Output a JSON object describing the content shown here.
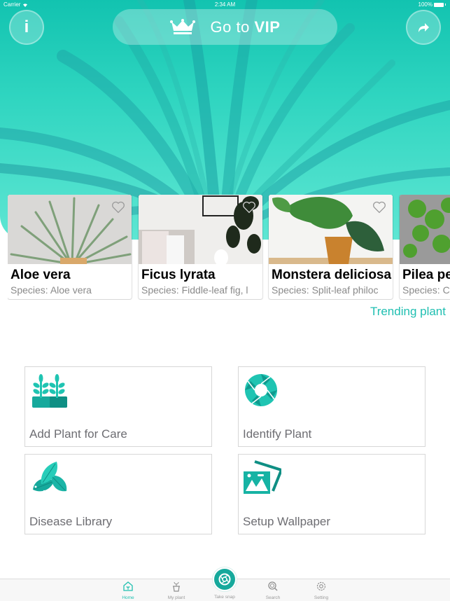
{
  "status_bar": {
    "carrier": "Carrier",
    "time": "2:34 AM",
    "battery": "100%"
  },
  "header": {
    "info_label": "i",
    "vip": {
      "prefix": "Go to ",
      "bold": "VIP"
    }
  },
  "trending": {
    "link_label": "Trending plant",
    "cards": [
      {
        "name": "Aloe vera",
        "species": "Species: Aloe vera",
        "favorite": false
      },
      {
        "name": "Ficus lyrata",
        "species": "Species: Fiddle-leaf fig, l",
        "favorite": false
      },
      {
        "name": "Monstera deliciosa",
        "species": "Species: Split-leaf philoc",
        "favorite": false
      },
      {
        "name": "Pilea pe",
        "species": "Species: C",
        "favorite": false
      }
    ]
  },
  "features": [
    {
      "label": "Add Plant for Care",
      "icon": "sprouts-icon"
    },
    {
      "label": "Identify Plant",
      "icon": "aperture-icon"
    },
    {
      "label": "Disease Library",
      "icon": "leaves-icon"
    },
    {
      "label": "Setup Wallpaper",
      "icon": "pictures-icon"
    }
  ],
  "tabbar": {
    "active": "Home",
    "items": [
      {
        "label": "Home",
        "icon": "home-icon"
      },
      {
        "label": "My plant",
        "icon": "potted-plant-icon"
      },
      {
        "label": "Take snap",
        "icon": "camera-shutter-icon"
      },
      {
        "label": "Search",
        "icon": "search-icon"
      },
      {
        "label": "Setting",
        "icon": "gear-icon"
      }
    ]
  },
  "colors": {
    "accent": "#1fbfb1",
    "hero_top": "#12c3b0",
    "hero_bottom": "#5ee6d3",
    "snap": "#16a99c"
  }
}
